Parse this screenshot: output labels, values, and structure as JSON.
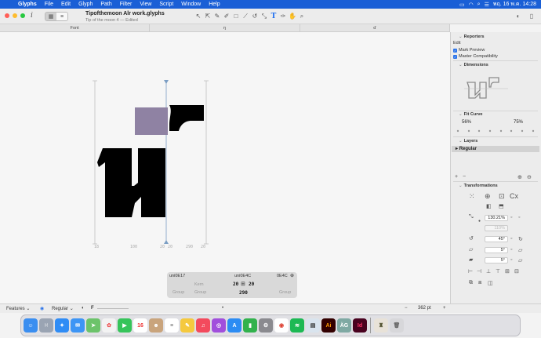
{
  "menubar": {
    "apple": "",
    "app_name": "Glyphs",
    "items": [
      "File",
      "Edit",
      "Glyph",
      "Path",
      "Filter",
      "View",
      "Script",
      "Window",
      "Help"
    ],
    "clock": "พฤ. 16 พ.ค.  14:28"
  },
  "window": {
    "title": "Tipofthemoon Alr work.glyphs",
    "subtitle": "Tip of the moon 4 — Edited"
  },
  "tabs": [
    "Font",
    "ŋ",
    "ɗ"
  ],
  "canvas": {
    "metrics": [
      "18",
      "100",
      "20",
      "20",
      "290",
      "20"
    ]
  },
  "kerning": {
    "left_glyph": "uni0E17",
    "center_glyph": "uni0E4C",
    "right_glyph": "0E4C",
    "kern_label": "Kern",
    "left_value": "20",
    "right_value": "20",
    "width_value": "290",
    "group_left": "Group",
    "group_center": "Group",
    "group_right": "Group"
  },
  "inspector": {
    "reporters_title": "Reporters",
    "reporters_edit": "Edit",
    "reporter_items": [
      "Mark Preview",
      "Master Compatibility"
    ],
    "dimensions_title": "Dimensions",
    "fit_curve_title": "Fit Curve",
    "fit_left": "56%",
    "fit_right": "75%",
    "layers_title": "Layers",
    "layer_name": "Regular",
    "transformations_title": "Transformations",
    "scale_value": "130.21%",
    "scale_value_2": "110%",
    "rotate_value": "45°",
    "slant_value": "5°",
    "slant_value_2": "5°"
  },
  "bottombar": {
    "features": "Features",
    "master": "Regular",
    "zoom": "362 pt"
  },
  "colors": {
    "menubar": "#1a5fd6",
    "selection_fill": "#8f82a3",
    "glyph_fill": "#000000",
    "accent": "#2b73e9"
  },
  "dock": [
    "finder",
    "launchpad",
    "safari",
    "mail",
    "maps",
    "photos",
    "facetime",
    "calendar",
    "contacts",
    "reminders",
    "notes",
    "music",
    "podcasts",
    "app-store",
    "numbers",
    "system-settings",
    "chrome",
    "spotify",
    "preview",
    "illustrator",
    "glyphs-app",
    "indesign",
    "archive",
    "trash"
  ]
}
